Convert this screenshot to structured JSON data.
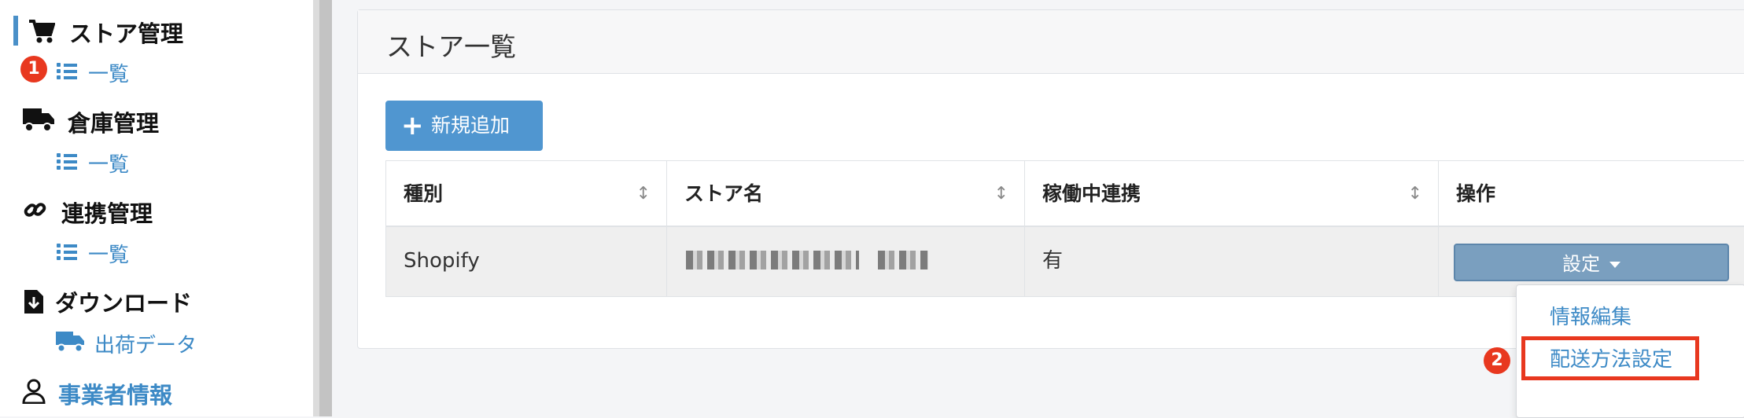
{
  "sidebar": {
    "groups": [
      {
        "title": "ストア管理",
        "icon": "cart-icon",
        "sub": "一覧"
      },
      {
        "title": "倉庫管理",
        "icon": "truck-icon",
        "sub": "一覧"
      },
      {
        "title": "連携管理",
        "icon": "link-icon",
        "sub": "一覧"
      },
      {
        "title": "ダウンロード",
        "icon": "download-file-icon",
        "sub": "出荷データ"
      },
      {
        "title": "事業者情報",
        "icon": "user-icon"
      }
    ],
    "badge1": "1",
    "accent": "#3d8ac6"
  },
  "main": {
    "card_title": "ストア一覧",
    "add_button": "新規追加",
    "table": {
      "headers": [
        "種別",
        "ストア名",
        "稼働中連携",
        "操作"
      ],
      "rows": [
        {
          "type": "Shopify",
          "store": "",
          "active": "有",
          "action": "設定"
        }
      ]
    },
    "dropdown": {
      "items": [
        "情報編集",
        "配送方法設定"
      ]
    },
    "badge2": "2",
    "highlight_color": "#e8381f"
  }
}
